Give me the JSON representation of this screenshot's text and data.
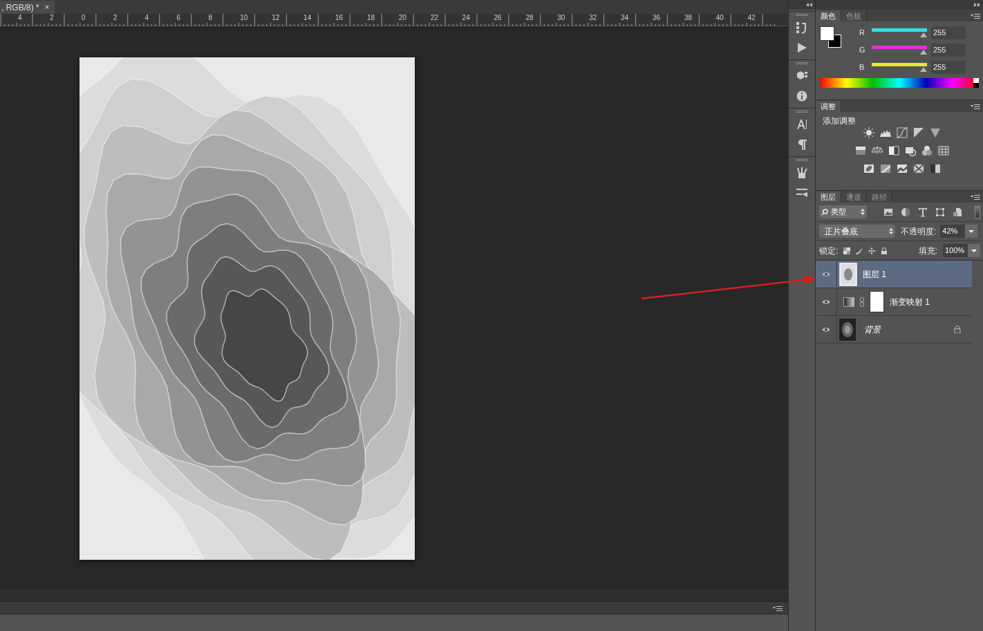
{
  "document_tab": {
    "title": ", RGB/8) *",
    "close": "×"
  },
  "ruler": {
    "labels": [
      "4",
      "2",
      "0",
      "2",
      "4",
      "6",
      "8",
      "10",
      "12",
      "14",
      "16",
      "18",
      "20",
      "22",
      "24",
      "26",
      "28",
      "30",
      "32",
      "34",
      "36",
      "38",
      "40",
      "42"
    ]
  },
  "color_panel": {
    "tabs": [
      {
        "label": "颜色",
        "selected": true
      },
      {
        "label": "色板",
        "selected": false
      }
    ],
    "channels": [
      {
        "name": "R",
        "color": "#33e0e6",
        "level": 1,
        "value": "255"
      },
      {
        "name": "G",
        "color": "#e033d6",
        "level": 1,
        "value": "255"
      },
      {
        "name": "B",
        "color": "#e6e633",
        "level": 1,
        "value": "255"
      }
    ]
  },
  "adjustments_panel": {
    "tabs": [
      {
        "label": "调整",
        "selected": true
      }
    ],
    "title": "添加调整"
  },
  "layers_panel": {
    "tabs": [
      {
        "label": "图层",
        "selected": true
      },
      {
        "label": "通道",
        "selected": false
      },
      {
        "label": "路径",
        "selected": false
      }
    ],
    "filter": "类型",
    "blend_mode": "正片叠底",
    "opacity_label": "不透明度:",
    "opacity": "42%",
    "lock_label": "锁定:",
    "fill_label": "填充:",
    "fill": "100%",
    "layers": [
      {
        "name": "图层 1",
        "kind": "pixel",
        "visible": true,
        "selected": true,
        "locked": false
      },
      {
        "name": "渐变映射 1",
        "kind": "adjustment",
        "visible": true,
        "selected": false,
        "locked": false
      },
      {
        "name": "背景",
        "kind": "background",
        "visible": true,
        "selected": false,
        "locked": true
      }
    ]
  }
}
